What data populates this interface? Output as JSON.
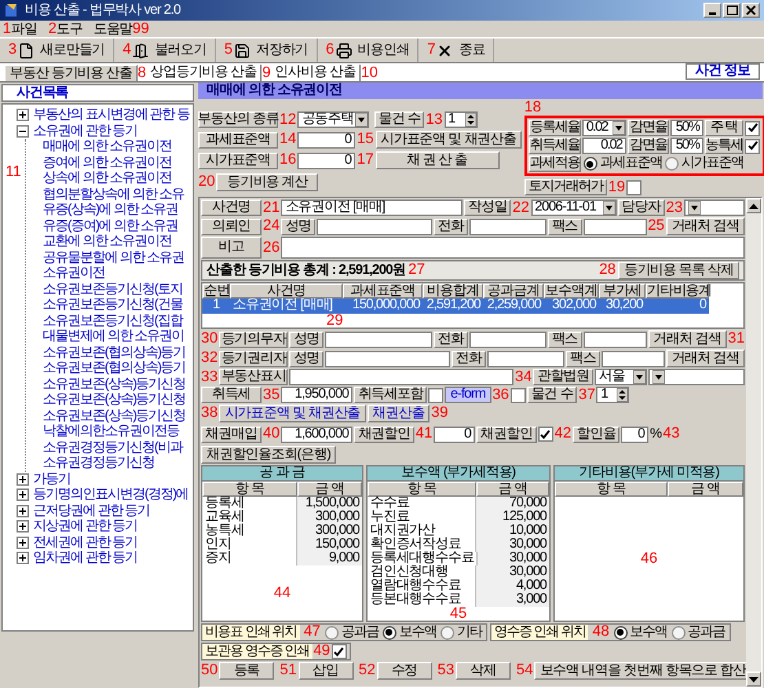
{
  "window": {
    "title": "비용 산출 - 법무박사 ver 2.0"
  },
  "menu": [
    {
      "label": "파일",
      "callout": "1"
    },
    {
      "label": "도구",
      "callout": "2"
    },
    {
      "label": "도움말",
      "callout_after": "99"
    }
  ],
  "toolbar": [
    {
      "label": "새로만들기",
      "callout": "3"
    },
    {
      "label": "불러오기",
      "callout": "4"
    },
    {
      "label": "저장하기",
      "callout": "5"
    },
    {
      "label": "비용인쇄",
      "callout": "6"
    },
    {
      "label": "종료",
      "callout": "7"
    }
  ],
  "tabs": [
    {
      "label": "부동산 등기비용 산출",
      "callout": "8",
      "selected": true
    },
    {
      "label": "상업등기비용 산출",
      "callout": "9",
      "selected": false
    },
    {
      "label": "인사비용 산출",
      "callout": "10",
      "selected": false
    }
  ],
  "case_info_button": "사건 정보",
  "sidebar": {
    "title": "사건목록",
    "callout": "11",
    "tree": [
      {
        "label": "부동산의 표시변경에 관한 등",
        "expanded": false
      },
      {
        "label": "소유권에 관한 등기",
        "expanded": true,
        "children": [
          {
            "label": "매매에 의한 소유권이전"
          },
          {
            "label": "증여에 의한 소유권이전"
          },
          {
            "label": "상속에 의한 소유권이전"
          },
          {
            "label": "협의분할상속에 의한 소유"
          },
          {
            "label": "유증(상속)에 의한 소유권"
          },
          {
            "label": "유증(증여)에 의한 소유권"
          },
          {
            "label": "교환에 의한 소유권이전"
          },
          {
            "label": "공유물분할에 의한 소유권"
          },
          {
            "label": "소유권이전"
          },
          {
            "label": "소유권보존등기신청(토지"
          },
          {
            "label": "소유권보존등기신청(건물"
          },
          {
            "label": "소유권보존등기신청(집합"
          },
          {
            "label": "대물변제에 의한 소유권이"
          },
          {
            "label": "소유권보존(협의상속)등기"
          },
          {
            "label": "소유권보존(협의상속)등기"
          },
          {
            "label": "소유권보존(상속)등기신청"
          },
          {
            "label": "소유권보존(상속)등기신청"
          },
          {
            "label": "소유권보존(상속)등기신청"
          },
          {
            "label": "낙찰에의한소유권이전등"
          },
          {
            "label": "소유권경정등기신청(비과"
          },
          {
            "label": "소유권경정등기신청"
          }
        ]
      },
      {
        "label": "가등기",
        "expanded": false
      },
      {
        "label": "등기명의인표시변경(경정)에",
        "expanded": false
      },
      {
        "label": "근저당권에 관한 등기",
        "expanded": false
      },
      {
        "label": "지상권에 관한 등기",
        "expanded": false
      },
      {
        "label": "전세권에 관한 등기",
        "expanded": false
      },
      {
        "label": "임차권에 관한 등기",
        "expanded": false
      }
    ]
  },
  "form": {
    "header": "매매에 의한 소유권이전",
    "property_type": {
      "label": "부동산의 종류",
      "value": "공동주택",
      "callout": "12"
    },
    "count": {
      "label": "물건 수",
      "value": "1",
      "callout": "13"
    },
    "tax_base": {
      "label": "과세표준액",
      "value": "0",
      "callout": "14"
    },
    "calc_both_button": {
      "label": "시가표준액 및 채권산출",
      "callout": "15"
    },
    "standard_price": {
      "label": "시가표준액",
      "value": "0",
      "callout": "16"
    },
    "bond_button": {
      "label": "채 권 산 출",
      "callout": "17"
    },
    "tax_box": {
      "callout": "18",
      "registration_rate": {
        "label": "등록세율",
        "value": "0.02"
      },
      "reduction_1": {
        "label": "감면율",
        "value": "50%"
      },
      "housing": {
        "label": "주 택",
        "checked": true
      },
      "acquisition_rate": {
        "label": "취득세율",
        "value": "0.02"
      },
      "reduction_2": {
        "label": "감면율",
        "value": "50%"
      },
      "rural_tax": {
        "label": "농특세",
        "checked": true
      },
      "apply": {
        "label": "과세적용",
        "options": [
          {
            "label": "과세표준액",
            "selected": true
          },
          {
            "label": "시가표준액",
            "selected": false
          }
        ]
      }
    },
    "land_permit": {
      "label": "토지거래허가",
      "callout": "19",
      "checked": false
    },
    "calc_button": {
      "label": "등기비용 계산",
      "callout": "20"
    }
  },
  "case": {
    "name": {
      "label": "사건명",
      "value": "소유권이전 [매매]",
      "callout": "21"
    },
    "date": {
      "label": "작성일",
      "value": "2006-11-01",
      "callout": "22"
    },
    "manager": {
      "label": "담당자",
      "callout": "23"
    },
    "client": {
      "label": "의뢰인",
      "callout": "24",
      "name_label": "성명",
      "phone_label": "전화",
      "fax_label": "팩스",
      "button": "거래처 검색",
      "button_callout": "25"
    },
    "note": {
      "label": "비고",
      "callout": "26"
    }
  },
  "total": {
    "text": "산출한 등기비용 총계 : 2,591,200원",
    "callout": "27",
    "button": "등기비용 목록 삭제",
    "button_callout": "28"
  },
  "table": {
    "callout": "29",
    "columns": [
      "순번",
      "사건명",
      "과세표준액",
      "비용합계",
      "공과금계",
      "보수액계",
      "부가세",
      "기타비용계"
    ],
    "rows": [
      {
        "cells": [
          "1",
          "소유권이전 [매매]",
          "150,000,000",
          "2,591,200",
          "2,259,000",
          "302,000",
          "30,200",
          "0"
        ],
        "selected": true
      }
    ]
  },
  "parties": [
    {
      "label": "등기의무자",
      "callout": "30",
      "name_label": "성명",
      "phone_label": "전화",
      "fax_label": "팩스",
      "button": "거래처 검색",
      "button_callout": "31"
    },
    {
      "label": "등기권리자",
      "callout": "32",
      "name_label": "성명",
      "phone_label": "전화",
      "fax_label": "팩스",
      "button": "거래처 검색"
    }
  ],
  "property": {
    "label": "부동산표시",
    "callout": "33",
    "court_label": "관할법원",
    "court_callout": "34",
    "court_value": "서울"
  },
  "acquisition": {
    "label": "취득세",
    "value": "1,950,000",
    "callout": "35",
    "include": {
      "label": "취득세포함",
      "checked": false
    },
    "eform": {
      "label": "e-form",
      "callout": "36",
      "checked": false
    },
    "count": {
      "label": "물건 수",
      "value": "1",
      "callout": "37"
    },
    "buttons": [
      {
        "label": "시가표준액 및 채권산출",
        "callout": "38"
      },
      {
        "label": "채권산출",
        "callout_after": "39"
      }
    ]
  },
  "bond": {
    "label": "채권매입",
    "value": "1,600,000",
    "callout": "40",
    "discount": {
      "label": "채권할인",
      "value": "0",
      "callout": "41"
    },
    "discount_check": {
      "label": "채권할인",
      "checked": true,
      "callout": "42"
    },
    "rate": {
      "label": "할인율",
      "value": "0",
      "unit": "%",
      "callout": "43"
    },
    "rate_button": "채권할인율조회(은행)"
  },
  "panels": [
    {
      "title": "공 과 금",
      "callout": "44",
      "columns": [
        "항 목",
        "금 액"
      ],
      "rows": [
        [
          "등록세",
          "1,500,000"
        ],
        [
          "교육세",
          "300,000"
        ],
        [
          "농특세",
          "300,000"
        ],
        [
          "인지",
          "150,000"
        ],
        [
          "증지",
          "9,000"
        ]
      ]
    },
    {
      "title": "보수액 (부가세적용)",
      "callout": "45",
      "columns": [
        "항 목",
        "금 액"
      ],
      "rows": [
        [
          "수수료",
          "70,000"
        ],
        [
          "누진료",
          "125,000"
        ],
        [
          "대지권가산",
          "10,000"
        ],
        [
          "확인증서작성료",
          "30,000"
        ],
        [
          "등록세대행수수료",
          "30,000"
        ],
        [
          "검인신청대행",
          "30,000"
        ],
        [
          "열람대행수수료",
          "4,000"
        ],
        [
          "등본대행수수료",
          "3,000"
        ]
      ]
    },
    {
      "title": "기타비용(부가세 미적용)",
      "callout": "46",
      "columns": [
        "항 목",
        "금 액"
      ]
    }
  ],
  "print_options": [
    {
      "label": "비용표 인쇄 위치",
      "callout": "47",
      "options": [
        {
          "label": "공과금",
          "selected": false
        },
        {
          "label": "보수액",
          "selected": true
        },
        {
          "label": "기타",
          "selected": false
        }
      ]
    },
    {
      "label": "영수증 인쇄 위치",
      "callout": "48",
      "options": [
        {
          "label": "보수액",
          "selected": true
        },
        {
          "label": "공과금",
          "selected": false
        }
      ]
    }
  ],
  "keep_receipt": {
    "label": "보관용 영수증 인쇄",
    "callout": "49",
    "checked": true
  },
  "bottom_buttons": [
    {
      "label": "등록",
      "callout": "50"
    },
    {
      "label": "삽입",
      "callout": "51"
    },
    {
      "label": "수정",
      "callout": "52"
    },
    {
      "label": "삭제",
      "callout": "53"
    },
    {
      "label": "보수액 내역을 첫번째 항목으로 합산",
      "callout": "54"
    }
  ]
}
